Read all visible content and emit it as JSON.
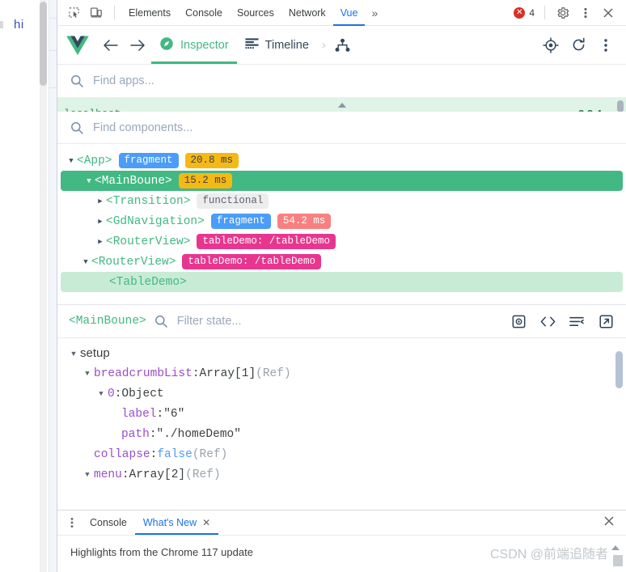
{
  "page_behind": {
    "text": "hi"
  },
  "devtools": {
    "toolbar": {
      "inspect_icon": "inspect-element-icon",
      "device_icon": "device-toolbar-icon",
      "tabs": [
        {
          "label": "Elements",
          "active": false
        },
        {
          "label": "Console",
          "active": false
        },
        {
          "label": "Sources",
          "active": false
        },
        {
          "label": "Network",
          "active": false
        },
        {
          "label": "Vue",
          "active": true
        }
      ],
      "more_tabs_icon": "chevron-double-right-icon",
      "error_badge": {
        "icon": "error-circle-icon",
        "count": "4"
      },
      "settings_icon": "gear-icon",
      "menu_icon": "vertical-dots-icon",
      "close_icon": "close-icon"
    },
    "vue_toolbar": {
      "logo_icon": "vue-logo-icon",
      "back_icon": "arrow-left-icon",
      "forward_icon": "arrow-right-icon",
      "tabs": [
        {
          "label": "Inspector",
          "icon": "compass-icon",
          "active": true
        },
        {
          "label": "Timeline",
          "icon": "timeline-icon",
          "active": false
        }
      ],
      "overflow_chevron": "chevron-right-icon",
      "hierarchy_icon": "component-hierarchy-icon",
      "target_icon": "target-crosshair-icon",
      "refresh_icon": "refresh-icon",
      "menu_icon": "vertical-dots-icon"
    },
    "app_search": {
      "icon": "search-icon",
      "placeholder": "Find apps...",
      "value": ""
    },
    "component_search": {
      "icon": "search-icon",
      "placeholder": "Find components...",
      "value": ""
    },
    "component_tree": [
      {
        "name": "<App>",
        "indent": 0,
        "arrow": "open",
        "state": "normal",
        "tags": [
          {
            "text": "fragment",
            "style": "fragment"
          },
          {
            "text": "20.8 ms",
            "style": "time-y"
          }
        ]
      },
      {
        "name": "<MainBoune>",
        "indent": 1,
        "arrow": "open",
        "state": "selected",
        "tags": [
          {
            "text": "15.2 ms",
            "style": "time-y"
          }
        ]
      },
      {
        "name": "<Transition>",
        "indent": 2,
        "arrow": "closed",
        "state": "normal",
        "tags": [
          {
            "text": "functional",
            "style": "functional"
          }
        ]
      },
      {
        "name": "<GdNavigation>",
        "indent": 2,
        "arrow": "closed",
        "state": "normal",
        "tags": [
          {
            "text": "fragment",
            "style": "fragment"
          },
          {
            "text": "54.2 ms",
            "style": "time-r"
          }
        ]
      },
      {
        "name": "<RouterView>",
        "indent": 2,
        "arrow": "closed",
        "state": "normal",
        "tags": [
          {
            "text": "tableDemo: /tableDemo",
            "style": "route"
          }
        ]
      },
      {
        "name": "<RouterView>",
        "indent": 1,
        "arrow": "open",
        "state": "normal",
        "tags": [
          {
            "text": "tableDemo: /tableDemo",
            "style": "route"
          }
        ]
      },
      {
        "name": "<TableDemo>",
        "indent": 2,
        "arrow": "blank",
        "state": "hovered",
        "tags": []
      }
    ],
    "state_panel": {
      "component_name": "<MainBoune>",
      "filter": {
        "icon": "search-icon",
        "placeholder": "Filter state...",
        "value": ""
      },
      "tools": [
        {
          "name": "inspect-dom-icon",
          "glyph": "dom"
        },
        {
          "name": "open-in-editor-icon",
          "glyph": "code"
        },
        {
          "name": "console-log-icon",
          "glyph": "lines"
        },
        {
          "name": "open-external-icon",
          "glyph": "external"
        }
      ],
      "rows": [
        {
          "indent": 0,
          "arrow": "open",
          "kind": "group",
          "key": "setup"
        },
        {
          "indent": 1,
          "arrow": "open",
          "kind": "prop",
          "key": "breadcrumbList",
          "value": "Array[1]",
          "suffix": "(Ref)"
        },
        {
          "indent": 2,
          "arrow": "open",
          "kind": "prop",
          "key": "0",
          "value": "Object",
          "suffix": ""
        },
        {
          "indent": 3,
          "arrow": "blank",
          "kind": "prop",
          "key": "label",
          "value": "\"6\"",
          "suffix": ""
        },
        {
          "indent": 3,
          "arrow": "blank",
          "kind": "prop",
          "key": "path",
          "value": "\"./homeDemo\"",
          "suffix": ""
        },
        {
          "indent": 1,
          "arrow": "blank",
          "kind": "prop",
          "key": "collapse",
          "value": "false",
          "suffix": "(Ref)",
          "value_type": "bool"
        },
        {
          "indent": 1,
          "arrow": "open",
          "kind": "prop",
          "key": "menu",
          "value": "Array[2]",
          "suffix": "(Ref)"
        }
      ]
    },
    "drawer": {
      "menu_icon": "vertical-dots-icon",
      "tabs": [
        {
          "label": "Console",
          "active": false,
          "closable": false
        },
        {
          "label": "What's New",
          "active": true,
          "closable": true
        }
      ],
      "close_icon": "close-icon",
      "content_text": "Highlights from the Chrome 117 update",
      "watermark": "CSDN @前端追随者"
    }
  },
  "colors": {
    "vue_green": "#42b883",
    "chrome_blue": "#1a73e8",
    "error_red": "#d93025",
    "fragment_blue": "#4a9df8",
    "time_yellow": "#f5b914",
    "time_red": "#f98080",
    "route_pink": "#e8368f",
    "prop_purple": "#9b4dca"
  }
}
